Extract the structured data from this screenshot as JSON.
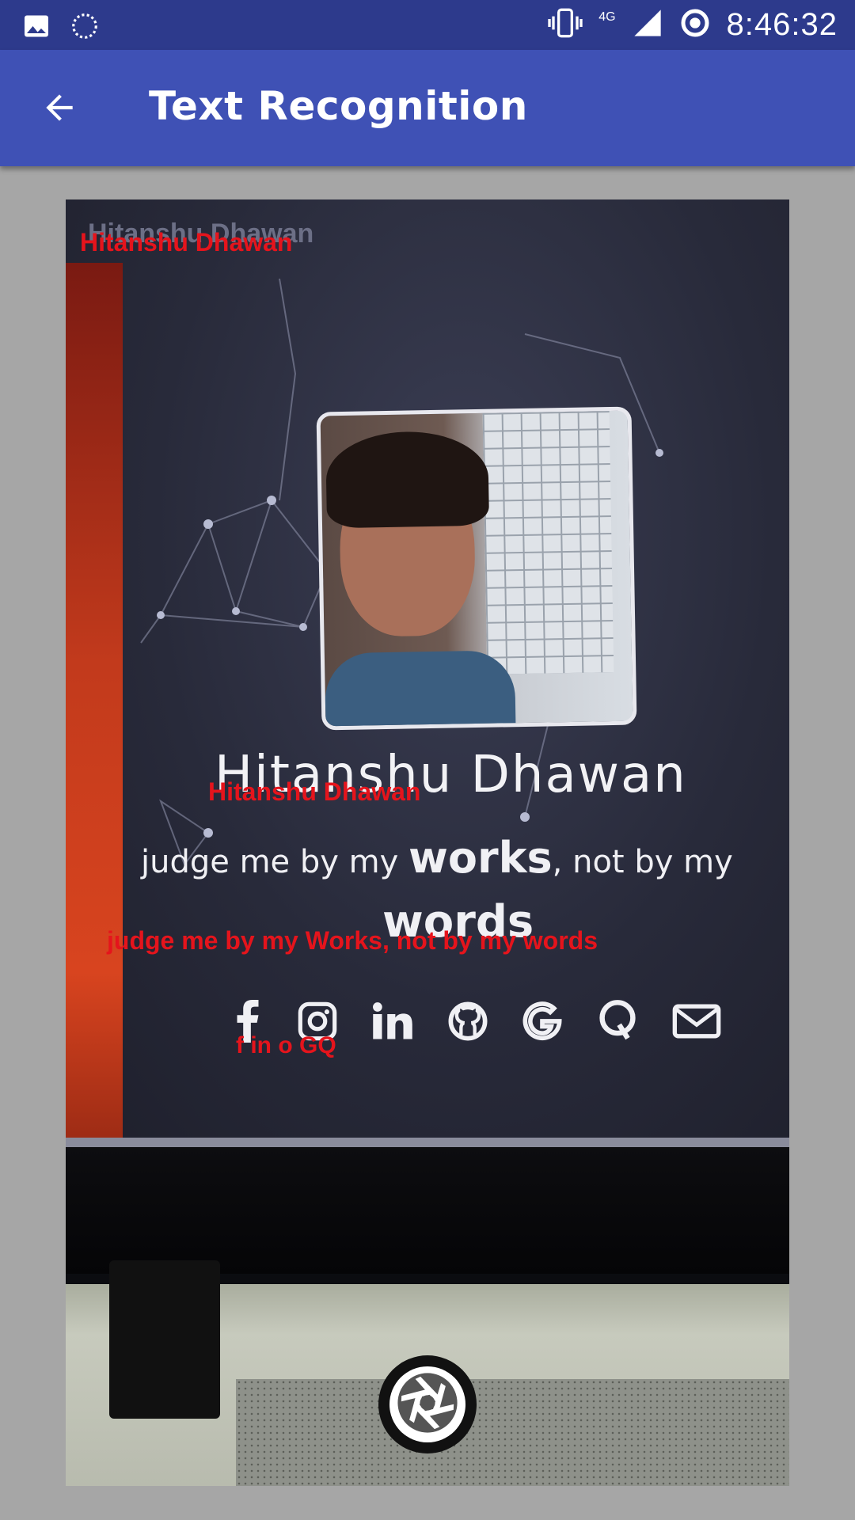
{
  "status_bar": {
    "time": "8:46:32",
    "network": "4G",
    "icons": [
      "image-icon",
      "sync-icon",
      "vibrate-icon",
      "signal-icon",
      "data-saver-icon"
    ]
  },
  "app_bar": {
    "title": "Text Recognition",
    "back_icon": "arrow-back-icon",
    "color": "#3f51b5",
    "status_color": "#2d3a8c"
  },
  "camera_preview": {
    "screen_text": {
      "header": "Hitanshu Dhawan",
      "name": "Hitanshu Dhawan",
      "tagline_prefix": "judge me by my ",
      "tagline_bold": "works",
      "tagline_suffix": ", not by my",
      "tagline_words": "words"
    },
    "social_icons": [
      "facebook-icon",
      "instagram-icon",
      "linkedin-icon",
      "github-icon",
      "google-icon",
      "quora-icon",
      "mail-icon"
    ]
  },
  "ocr_results": [
    {
      "text": "Hitanshu Dhawan"
    },
    {
      "text": "Hitanshu Dhawan"
    },
    {
      "text": "judge me by my Works, not by my words"
    },
    {
      "text": "f in o GQ"
    }
  ],
  "overlay_color": "#e5141c",
  "shutter": {
    "icon": "camera-shutter-icon"
  }
}
